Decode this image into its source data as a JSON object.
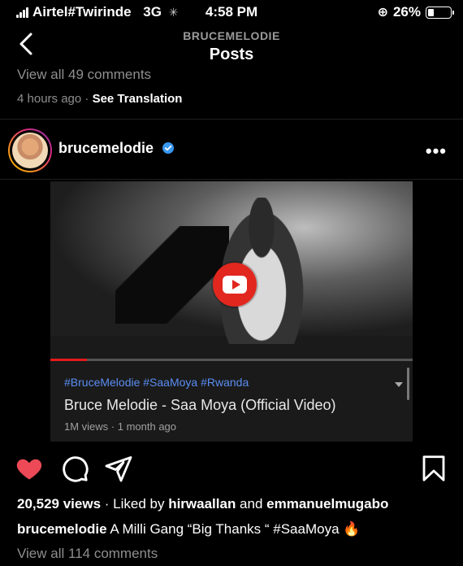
{
  "status_bar": {
    "carrier": "Airtel#Twirinde",
    "network": "3G",
    "time": "4:58 PM",
    "battery": "26%",
    "battery_level": 0.26
  },
  "header": {
    "subtitle": "BRUCEMELODIE",
    "title": "Posts"
  },
  "previous_post": {
    "comments_link": "View all 49 comments",
    "time_ago": "4 hours ago",
    "separator": "·",
    "see_translation": "See Translation"
  },
  "post": {
    "username": "brucemelodie",
    "verified": true,
    "more_label": "•••",
    "video": {
      "hashtags": "#BruceMelodie #SaaMoya #Rwanda",
      "title": "Bruce Melodie - Saa Moya (Official Video)",
      "meta": "1M views · 1 month ago",
      "progress": 0.1
    },
    "actions": {
      "like_icon": "heart-icon",
      "comment_icon": "comment-icon",
      "share_icon": "share-icon",
      "save_icon": "bookmark-icon",
      "liked": true,
      "like_color": "#ed4956"
    },
    "views": "20,529 views",
    "liked_by_prefix": " · Liked by ",
    "liked_by_1": "hirwaallan",
    "liked_by_and": " and ",
    "liked_by_2": "emmanuelmugabo",
    "caption_user": "brucemelodie",
    "caption_text": " A Milli Gang “Big Thanks “ #SaaMoya 🔥",
    "comments_link": "View all 114 comments"
  }
}
